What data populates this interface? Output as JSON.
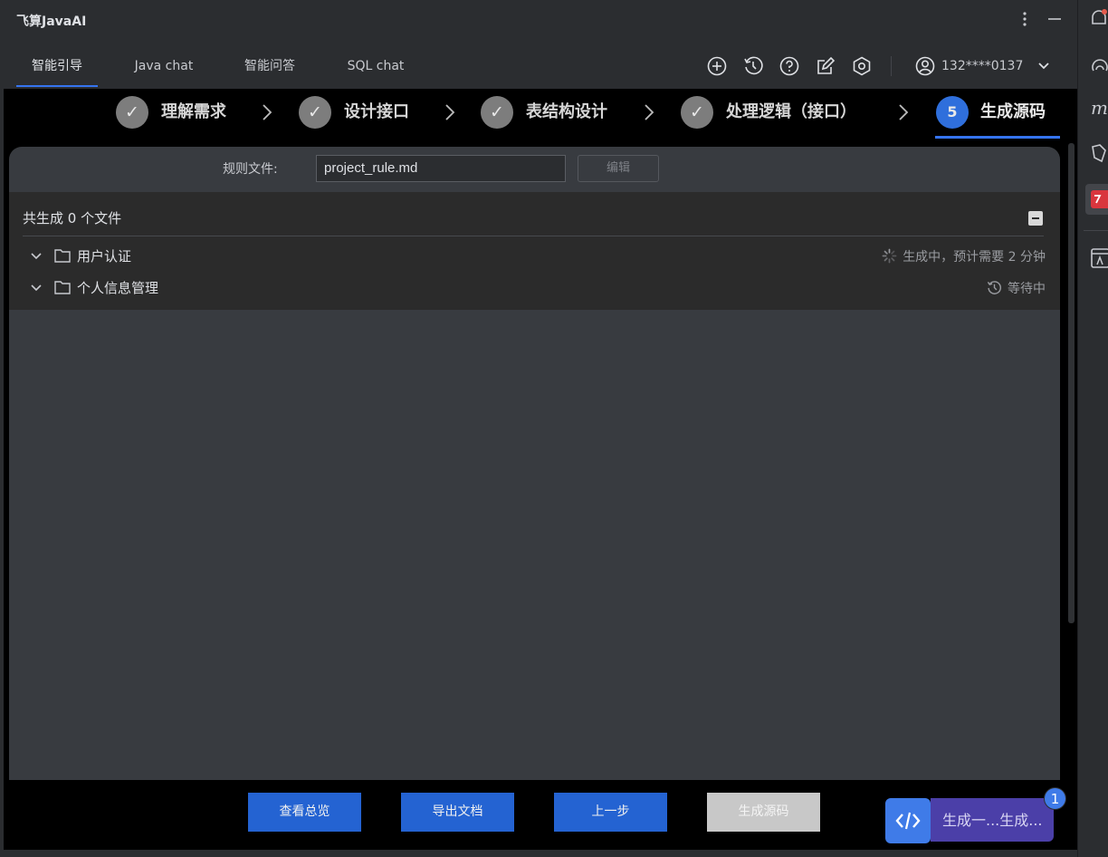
{
  "app": {
    "title": "飞算JavaAI"
  },
  "tabs": [
    {
      "label": "智能引导",
      "active": true
    },
    {
      "label": "Java chat",
      "active": false
    },
    {
      "label": "智能问答",
      "active": false
    },
    {
      "label": "SQL chat",
      "active": false
    }
  ],
  "toolbar": {
    "icons": [
      "add-circle-icon",
      "history-icon",
      "help-icon",
      "edit-icon",
      "settings-icon"
    ],
    "user_phone": "132****0137"
  },
  "steps": [
    {
      "marker": "✓",
      "label": "理解需求",
      "state": "done"
    },
    {
      "marker": "✓",
      "label": "设计接口",
      "state": "done"
    },
    {
      "marker": "✓",
      "label": "表结构设计",
      "state": "done"
    },
    {
      "marker": "✓",
      "label": "处理逻辑（接口）",
      "state": "done"
    },
    {
      "marker": "5",
      "label": "生成源码",
      "state": "current"
    }
  ],
  "rule": {
    "label": "规则文件:",
    "value": "project_rule.md",
    "edit_label": "编辑"
  },
  "files": {
    "summary": "共生成 0 个文件",
    "groups": [
      {
        "name": "用户认证",
        "status": "生成中，预计需要 2 分钟",
        "status_icon": "spinner-icon"
      },
      {
        "name": "个人信息管理",
        "status": "等待中",
        "status_icon": "clock-icon"
      }
    ]
  },
  "actions": {
    "overview": "查看总览",
    "export": "导出文档",
    "previous": "上一步",
    "generate": "生成源码"
  },
  "float_task": {
    "label": "生成一...生成...",
    "badge": "1"
  },
  "colors": {
    "accent": "#3574f0",
    "button_blue": "#2463d2",
    "step_done": "#7d7d7d",
    "task_purple": "#4b3fa8"
  }
}
